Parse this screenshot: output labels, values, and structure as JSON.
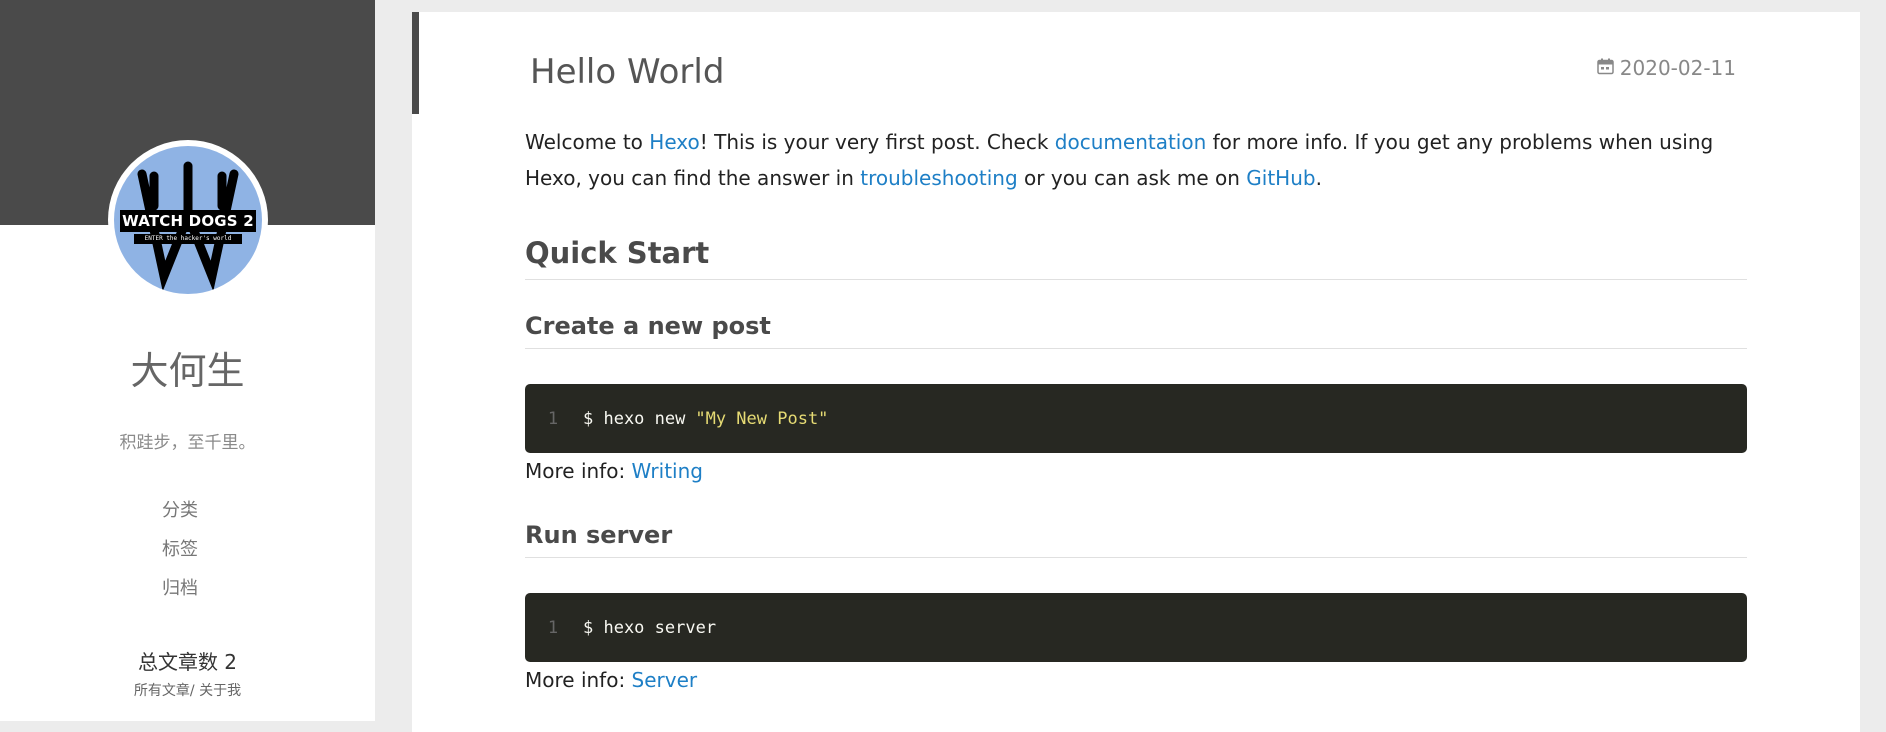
{
  "sidebar": {
    "avatar_logo_text": "WATCH DOGS 2",
    "avatar_logo_tagline": "ENTER the hacker's world",
    "author": "大何生",
    "motto": "积跬步，至千里。",
    "nav": [
      "分类",
      "标签",
      "归档"
    ],
    "article_count": "总文章数 2",
    "links": {
      "all_posts": "所有文章",
      "separator": "/",
      "about": "关于我"
    }
  },
  "post": {
    "title": "Hello World",
    "date": "2020-02-11",
    "date_icon": "calendar-icon",
    "intro": {
      "t1": "Welcome to ",
      "hexo_link": "Hexo",
      "t2": "! This is your very first post. Check ",
      "documentation_link": "documentation",
      "t3": " for more info. If you get any problems when using Hexo, you can find the answer in ",
      "troubleshooting_link": "troubleshooting",
      "t4": " or you can ask me on ",
      "github_link": "GitHub",
      "t5": "."
    },
    "quick_start_heading": "Quick Start",
    "sections": [
      {
        "heading": "Create a new post",
        "code_line_number": "1",
        "code_command": "$ hexo new",
        "code_string": "\"My New Post\"",
        "more_info_label": "More info: ",
        "more_info_link": "Writing"
      },
      {
        "heading": "Run server",
        "code_line_number": "1",
        "code_command": "$ hexo server",
        "code_string": "",
        "more_info_label": "More info: ",
        "more_info_link": "Server"
      }
    ]
  },
  "colors": {
    "link": "#1e7fc6",
    "sidebar_banner": "#4a4a4a",
    "code_background": "#272822",
    "code_string": "#e6db74",
    "avatar_background": "#8fb3e4"
  }
}
